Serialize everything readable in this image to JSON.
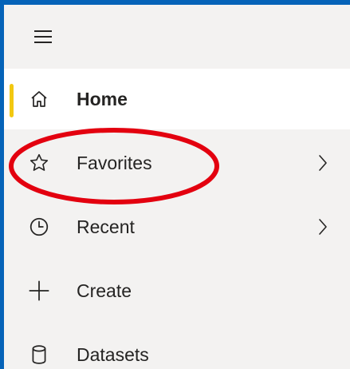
{
  "nav": {
    "menu_icon": "hamburger-menu-icon",
    "items": [
      {
        "label": "Home",
        "icon": "home-icon",
        "active": true,
        "has_submenu": false
      },
      {
        "label": "Favorites",
        "icon": "star-icon",
        "active": false,
        "has_submenu": true
      },
      {
        "label": "Recent",
        "icon": "clock-icon",
        "active": false,
        "has_submenu": true
      },
      {
        "label": "Create",
        "icon": "plus-icon",
        "active": false,
        "has_submenu": false
      },
      {
        "label": "Datasets",
        "icon": "database-icon",
        "active": false,
        "has_submenu": false
      }
    ]
  },
  "colors": {
    "frame_border": "#0563b8",
    "nav_background": "#f3f2f1",
    "active_background": "#ffffff",
    "active_indicator": "#f2c811",
    "text": "#252423",
    "annotation_circle": "#e3000f"
  }
}
